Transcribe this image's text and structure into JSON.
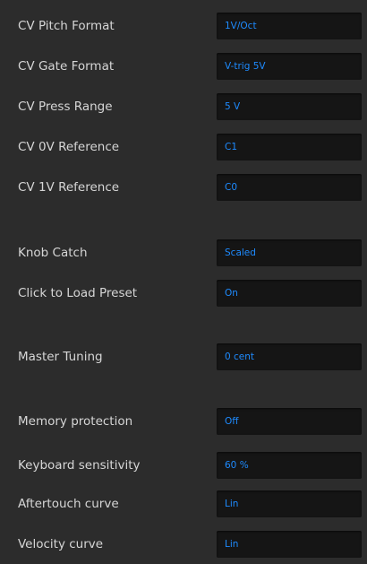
{
  "settings": [
    {
      "label": "CV Pitch Format",
      "value": "1V/Oct"
    },
    {
      "label": "CV Gate Format",
      "value": "V-trig 5V"
    },
    {
      "label": "CV Press Range",
      "value": "5 V"
    },
    {
      "label": "CV 0V Reference",
      "value": "C1"
    },
    {
      "label": "CV 1V Reference",
      "value": "C0"
    },
    {
      "label": "Knob Catch",
      "value": "Scaled"
    },
    {
      "label": "Click to Load Preset",
      "value": "On"
    },
    {
      "label": "Master Tuning",
      "value": "0 cent"
    },
    {
      "label": "Memory protection",
      "value": "Off"
    },
    {
      "label": "Keyboard sensitivity",
      "value": "60 %"
    },
    {
      "label": "Aftertouch curve",
      "value": "Lin"
    },
    {
      "label": "Velocity curve",
      "value": "Lin"
    }
  ],
  "colors": {
    "background": "#2c2c2c",
    "label_text": "#d6d6d6",
    "field_background": "#151515",
    "value_text": "#1e8bff"
  }
}
